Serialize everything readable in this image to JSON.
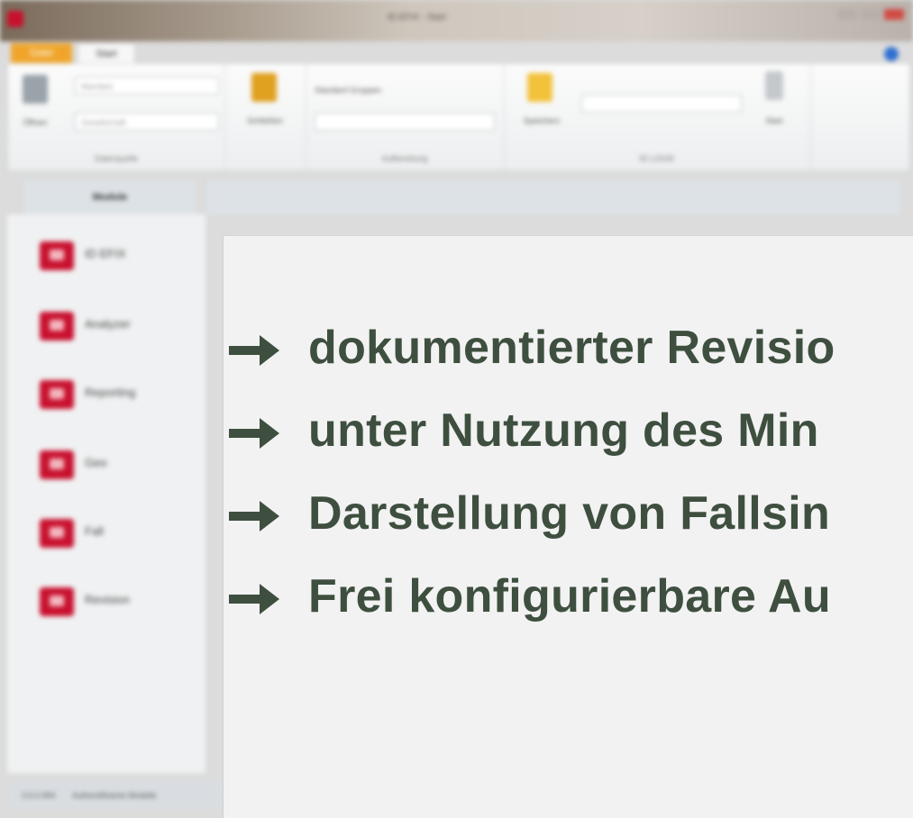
{
  "window": {
    "title": "ID EFIX - Start",
    "app_icon": "app-logo-icon"
  },
  "tabs": {
    "file": "Datei",
    "start": "Start"
  },
  "ribbon": {
    "groups": [
      {
        "label": "Datenquelle"
      },
      {
        "label": "Aufbereitung"
      },
      {
        "label": "ID LOGIK"
      }
    ],
    "open_label": "Öffnen",
    "close_label": "Schließen",
    "save_label": "Speichern",
    "start_label": "Start",
    "combo1": "Mandant",
    "combo2": "Gesellschaft",
    "filter_group_label": "Standard Gruppen",
    "filter_input": "",
    "logic_combo": ""
  },
  "modules": {
    "header": "Module",
    "items": [
      {
        "label": "ID EFIX"
      },
      {
        "label": "Analyzer"
      },
      {
        "label": "Reporting"
      },
      {
        "label": "Geo"
      },
      {
        "label": "Fall"
      },
      {
        "label": "Revision"
      }
    ]
  },
  "statusbar": {
    "version": "3.5.0.994",
    "text": "Authentifizierte Modelle"
  },
  "slide": {
    "bullets": [
      "dokumentierter Revisio",
      "unter Nutzung des Min",
      "Darstellung von Fallsin",
      "Frei konfigurierbare Au"
    ]
  },
  "colors": {
    "accent_red": "#c8102e",
    "file_tab": "#f0a52a",
    "slide_text": "#3e4f3f"
  }
}
